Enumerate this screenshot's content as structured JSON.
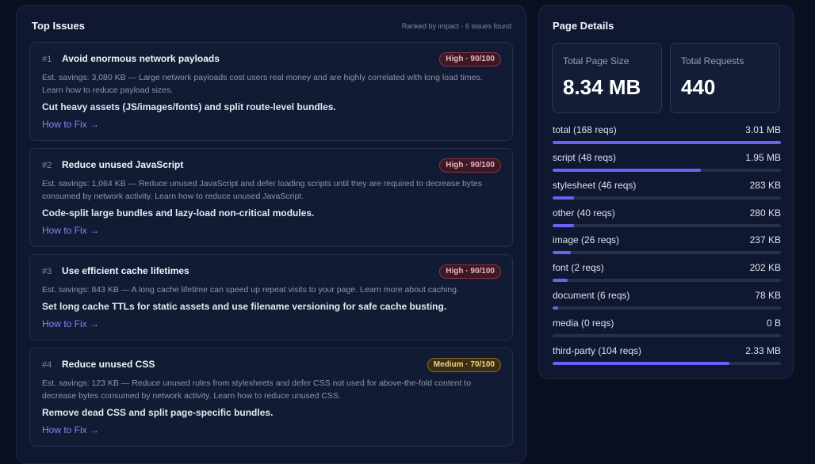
{
  "issues_panel": {
    "title": "Top Issues",
    "meta": "Ranked by impact · 6 issues found",
    "issues": [
      {
        "rank": "#1",
        "title": "Avoid enormous network payloads",
        "badge": "High · 90/100",
        "severity": "high",
        "description": "Est. savings: 3,080 KB — Large network payloads cost users real money and are highly correlated with long load times. Learn how to reduce payload sizes.",
        "fix": "Cut heavy assets (JS/images/fonts) and split route-level bundles.",
        "link": "How to Fix →"
      },
      {
        "rank": "#2",
        "title": "Reduce unused JavaScript",
        "badge": "High · 90/100",
        "severity": "high",
        "description": "Est. savings: 1,064 KB — Reduce unused JavaScript and defer loading scripts until they are required to decrease bytes consumed by network activity. Learn how to reduce unused JavaScript.",
        "fix": "Code-split large bundles and lazy-load non-critical modules.",
        "link": "How to Fix →"
      },
      {
        "rank": "#3",
        "title": "Use efficient cache lifetimes",
        "badge": "High · 90/100",
        "severity": "high",
        "description": "Est. savings: 843 KB — A long cache lifetime can speed up repeat visits to your page. Learn more about caching.",
        "fix": "Set long cache TTLs for static assets and use filename versioning for safe cache busting.",
        "link": "How to Fix →"
      },
      {
        "rank": "#4",
        "title": "Reduce unused CSS",
        "badge": "Medium · 70/100",
        "severity": "medium",
        "description": "Est. savings: 123 KB — Reduce unused rules from stylesheets and defer CSS not used for above-the-fold content to decrease bytes consumed by network activity. Learn how to reduce unused CSS.",
        "fix": "Remove dead CSS and split page-specific bundles.",
        "link": "How to Fix →"
      }
    ]
  },
  "details_panel": {
    "title": "Page Details",
    "total_size_label": "Total Page Size",
    "total_size_value": "8.34 MB",
    "total_requests_label": "Total Requests",
    "total_requests_value": "440",
    "resources": [
      {
        "label": "total (168 reqs)",
        "size": "3.01 MB",
        "fraction": 1.0
      },
      {
        "label": "script (48 reqs)",
        "size": "1.95 MB",
        "fraction": 0.65
      },
      {
        "label": "stylesheet (46 reqs)",
        "size": "283 KB",
        "fraction": 0.094
      },
      {
        "label": "other (40 reqs)",
        "size": "280 KB",
        "fraction": 0.093
      },
      {
        "label": "image (26 reqs)",
        "size": "237 KB",
        "fraction": 0.079
      },
      {
        "label": "font (2 reqs)",
        "size": "202 KB",
        "fraction": 0.067
      },
      {
        "label": "document (6 reqs)",
        "size": "78 KB",
        "fraction": 0.026
      },
      {
        "label": "media (0 reqs)",
        "size": "0 B",
        "fraction": 0.0
      },
      {
        "label": "third-party (104 reqs)",
        "size": "2.33 MB",
        "fraction": 0.774
      }
    ]
  },
  "colors": {
    "accent": "#6a62f2",
    "link": "#7d8cf2",
    "high_badge": "#f0b0bb",
    "medium_badge": "#f2d38a"
  }
}
